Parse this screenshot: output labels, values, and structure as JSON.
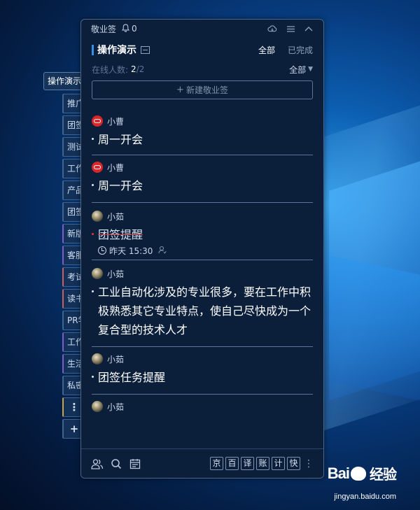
{
  "window": {
    "title": "敬业签",
    "notification_count": "0"
  },
  "header": {
    "group_name": "操作演示",
    "filter_all": "全部",
    "filter_done": "已完成"
  },
  "online": {
    "label": "在线人数:",
    "current": "2",
    "total": "/2",
    "dropdown": "全部"
  },
  "new_note_button": "新建敬业签",
  "tabs": {
    "active": "操作演示",
    "items": [
      "推广",
      "团签",
      "测试",
      "工作",
      "产品",
      "团签",
      "新版",
      "客服",
      "考试",
      "读书",
      "PR学",
      "工作",
      "生活",
      "私密"
    ],
    "more_symbol": "⋮",
    "add_symbol": "+"
  },
  "notes": [
    {
      "author": "小曹",
      "text": "周一开会"
    },
    {
      "author": "小曹",
      "text": "周一开会"
    },
    {
      "author": "小茹",
      "text": "团签提醒",
      "time": "昨天 15:30"
    },
    {
      "author": "小茹",
      "text": "工业自动化涉及的专业很多，要在工作中积极熟悉其它专业特点，使自己尽快成为一个复合型的技术人才"
    },
    {
      "author": "小茹",
      "text": "团签任务提醒"
    },
    {
      "author": "小茹"
    }
  ],
  "footer": {
    "quick_buttons": [
      "京",
      "百",
      "译",
      "账",
      "计",
      "快"
    ],
    "more_symbol": "⋮"
  },
  "watermark": {
    "logo_left": "Bai",
    "logo_right": "经验",
    "url": "jingyan.baidu.com"
  },
  "colors": {
    "accent": "#3a8ee6",
    "strike": "#e0373a",
    "panel_bg": "#0b1f3b"
  }
}
